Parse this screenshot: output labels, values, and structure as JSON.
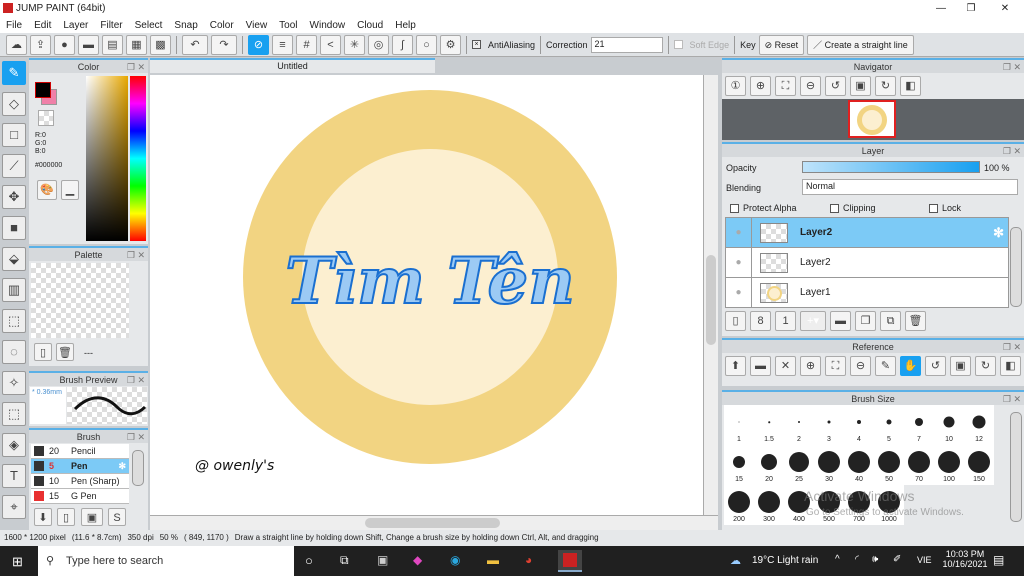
{
  "app": {
    "title": "JUMP PAINT (64bit)",
    "window_controls": [
      "—",
      "❐",
      "✕"
    ]
  },
  "menu": [
    "File",
    "Edit",
    "Layer",
    "Filter",
    "Select",
    "Snap",
    "Color",
    "View",
    "Tool",
    "Window",
    "Cloud",
    "Help"
  ],
  "toolbar": {
    "antialiasing_label": "AntiAliasing",
    "correction_label": "Correction",
    "correction_value": "21",
    "soft_edge_label": "Soft Edge",
    "key_label": "Key",
    "reset_label": "Reset",
    "straight_line_label": "Create a straight line"
  },
  "color": {
    "title": "Color",
    "r": "R:0",
    "g": "G:0",
    "b": "B:0",
    "hex": "#000000",
    "fg": "#000000",
    "bg": "#f080a8"
  },
  "palette": {
    "title": "Palette",
    "more": "---"
  },
  "brush_preview": {
    "title": "Brush Preview",
    "size": "* 0.36mm"
  },
  "brush": {
    "title": "Brush",
    "items": [
      {
        "size": "20",
        "name": "Pencil",
        "color": "#333333"
      },
      {
        "size": "5",
        "name": "Pen",
        "color": "#333333"
      },
      {
        "size": "10",
        "name": "Pen (Sharp)",
        "color": "#333333"
      },
      {
        "size": "15",
        "name": "G Pen",
        "color": "#e83030"
      }
    ]
  },
  "canvas": {
    "tab": "Untitled",
    "artwork_text": "Tìm Tên",
    "signature": "@ owenly's",
    "colors": {
      "outer": "#f2d482",
      "inner": "#fcefd0",
      "text": "#9ccaf4",
      "stroke": "#1a6fd0"
    }
  },
  "navigator": {
    "title": "Navigator"
  },
  "layer": {
    "title": "Layer",
    "opacity_label": "Opacity",
    "opacity_value": "100 %",
    "opacity": 100,
    "blending_label": "Blending",
    "blending_value": "Normal",
    "protect_alpha": "Protect Alpha",
    "clipping": "Clipping",
    "lock": "Lock",
    "layers": [
      "Layer2",
      "Layer2",
      "Layer1"
    ]
  },
  "reference": {
    "title": "Reference"
  },
  "brush_size": {
    "title": "Brush Size",
    "sizes": [
      "1",
      "1.5",
      "2",
      "3",
      "4",
      "5",
      "7",
      "10",
      "12",
      "15",
      "20",
      "25",
      "30",
      "40",
      "50",
      "70",
      "100",
      "150",
      "200",
      "300",
      "400",
      "500",
      "700",
      "1000"
    ],
    "watermark1": "Activate Windows",
    "watermark2": "Go to Settings to activate Windows."
  },
  "status": {
    "dimensions": "1600 * 1200 pixel",
    "physical": "(11.6 * 8.7cm)",
    "dpi": "350 dpi",
    "zoom": "50 %",
    "coords": "( 849, 1170 )",
    "hint": "Draw a straight line by holding down Shift, Change a brush size by holding down Ctrl, Alt, and dragging"
  },
  "taskbar": {
    "search_placeholder": "Type here to search",
    "weather": "19°C  Light rain",
    "lang": "VIE",
    "time": "10:03 PM",
    "date": "10/16/2021"
  }
}
